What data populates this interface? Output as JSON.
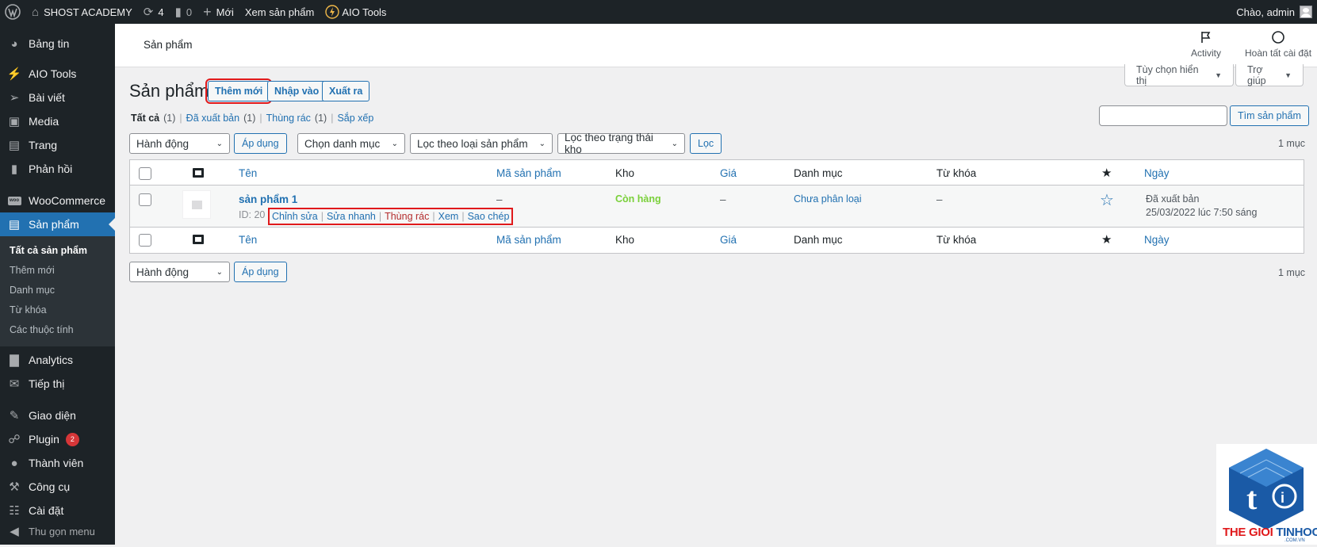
{
  "adminbar": {
    "site_name": "SHOST ACADEMY",
    "updates_count": "4",
    "comments_count": "0",
    "new_label": "Mới",
    "view_products": "Xem sản phẩm",
    "aio_tools": "AIO Tools",
    "greeting": "Chào, admin"
  },
  "sidebar": {
    "items": [
      {
        "label": "Bảng tin",
        "icon": "dashboard-icon"
      },
      {
        "label": "AIO Tools",
        "icon": "bolt-icon"
      },
      {
        "label": "Bài viết",
        "icon": "pin-icon"
      },
      {
        "label": "Media",
        "icon": "media-icon"
      },
      {
        "label": "Trang",
        "icon": "page-icon"
      },
      {
        "label": "Phản hồi",
        "icon": "comment-icon"
      },
      {
        "label": "WooCommerce",
        "icon": "woo-icon"
      },
      {
        "label": "Sản phẩm",
        "icon": "product-icon"
      },
      {
        "label": "Analytics",
        "icon": "chart-bar-icon"
      },
      {
        "label": "Tiếp thị",
        "icon": "megaphone-icon"
      },
      {
        "label": "Giao diện",
        "icon": "brush-icon"
      },
      {
        "label": "Plugin",
        "icon": "plug-icon",
        "badge": "2"
      },
      {
        "label": "Thành viên",
        "icon": "user-icon"
      },
      {
        "label": "Công cụ",
        "icon": "wrench-icon"
      },
      {
        "label": "Cài đặt",
        "icon": "settings-icon"
      }
    ],
    "submenu": [
      "Tất cả sản phẩm",
      "Thêm mới",
      "Danh mục",
      "Từ khóa",
      "Các thuộc tính"
    ],
    "collapse_label": "Thu gọn menu"
  },
  "header": {
    "title": "Sản phẩm",
    "activity": "Activity",
    "finish_setup": "Hoàn tất cài đặt"
  },
  "screen_options": "Tùy chọn hiển thị",
  "help": "Trợ giúp",
  "page": {
    "title": "Sản phẩm",
    "add_new": "Thêm mới",
    "import": "Nhập vào",
    "export": "Xuất ra"
  },
  "views": {
    "all": "Tất cả",
    "all_count": "(1)",
    "published": "Đã xuất bản",
    "published_count": "(1)",
    "trash": "Thùng rác",
    "trash_count": "(1)",
    "sort": "Sắp xếp",
    "sep": "|"
  },
  "search": {
    "button": "Tìm sản phẩm",
    "value": ""
  },
  "filters": {
    "bulk_action": "Hành động",
    "apply": "Áp dụng",
    "category": "Chọn danh mục",
    "product_type": "Lọc theo loại sản phẩm",
    "stock_status": "Lọc theo trạng thái kho",
    "filter": "Lọc",
    "count": "1 mục"
  },
  "table": {
    "columns": {
      "name": "Tên",
      "sku": "Mã sản phẩm",
      "stock": "Kho",
      "price": "Giá",
      "category": "Danh mục",
      "tags": "Từ khóa",
      "date": "Ngày"
    },
    "rows": [
      {
        "name": "sản phẩm 1",
        "id_label": "ID: 20",
        "sku": "–",
        "stock": "Còn hàng",
        "price": "–",
        "category": "Chưa phân loại",
        "tags": "–",
        "status": "Đã xuất bản",
        "date": "25/03/2022 lúc 7:50 sáng",
        "actions": {
          "edit": "Chỉnh sửa",
          "quick_edit": "Sửa nhanh",
          "trash": "Thùng rác",
          "view": "Xem",
          "duplicate": "Sao chép",
          "sep": "|"
        }
      }
    ]
  },
  "colors": {
    "adminbar_bg": "#1d2327",
    "accent": "#2271b1",
    "in_stock": "#7ad03a",
    "highlight_box": "#e0191b"
  },
  "watermark": {
    "line1": "THE GIOI",
    "line2": "TINHOC",
    "suffix": ".COM.VN"
  }
}
